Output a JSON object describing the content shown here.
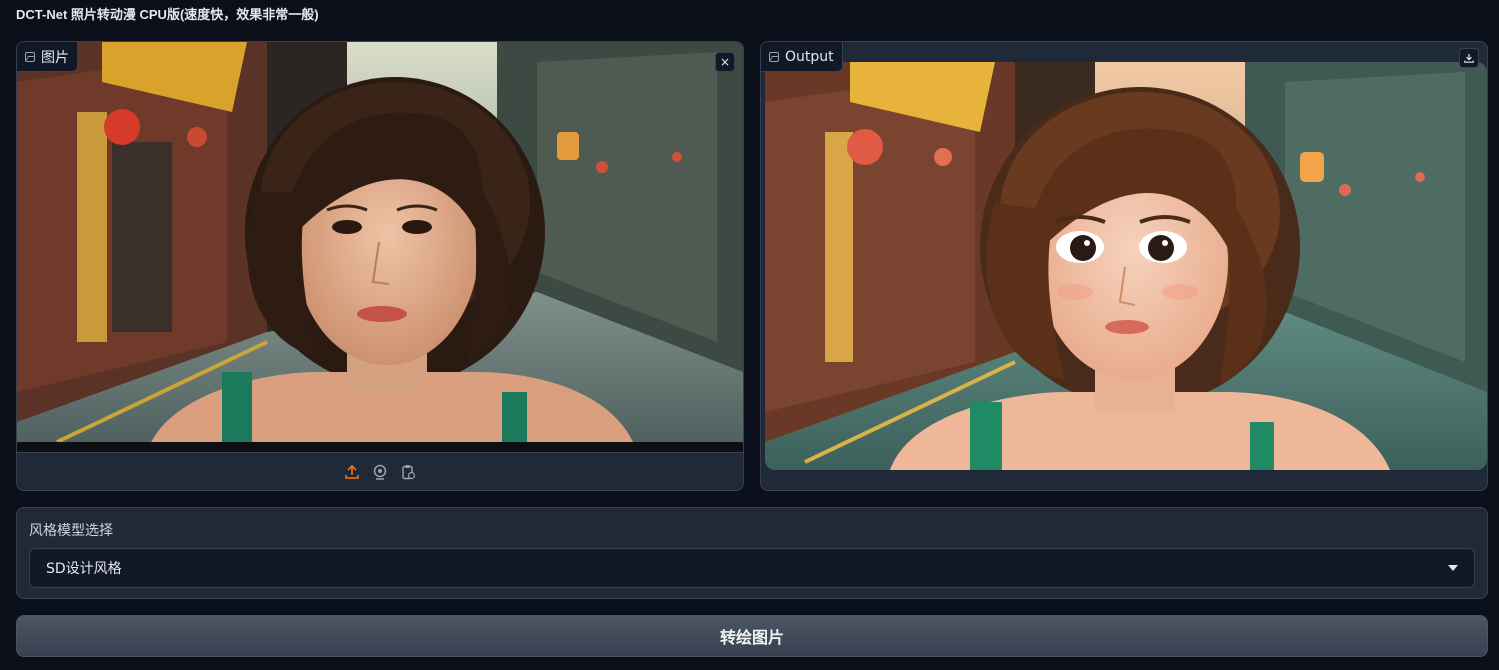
{
  "app": {
    "title": "DCT-Net 照片转动漫 CPU版(速度快，效果非常一般)"
  },
  "input_panel": {
    "label": "图片",
    "close_glyph": "×",
    "sources": [
      {
        "icon": "upload-icon",
        "color": "#f97316"
      },
      {
        "icon": "webcam-icon",
        "color": "#9ca3af"
      },
      {
        "icon": "clipboard-icon",
        "color": "#9ca3af"
      }
    ]
  },
  "output_panel": {
    "label": "Output",
    "download_icon": "download-icon"
  },
  "style_select": {
    "label": "风格模型选择",
    "selected": "SD设计风格"
  },
  "submit": {
    "label": "转绘图片"
  },
  "colors": {
    "background": "#0b0f19",
    "panel": "#1f2937",
    "border": "#374151",
    "accent_upload": "#f97316"
  }
}
